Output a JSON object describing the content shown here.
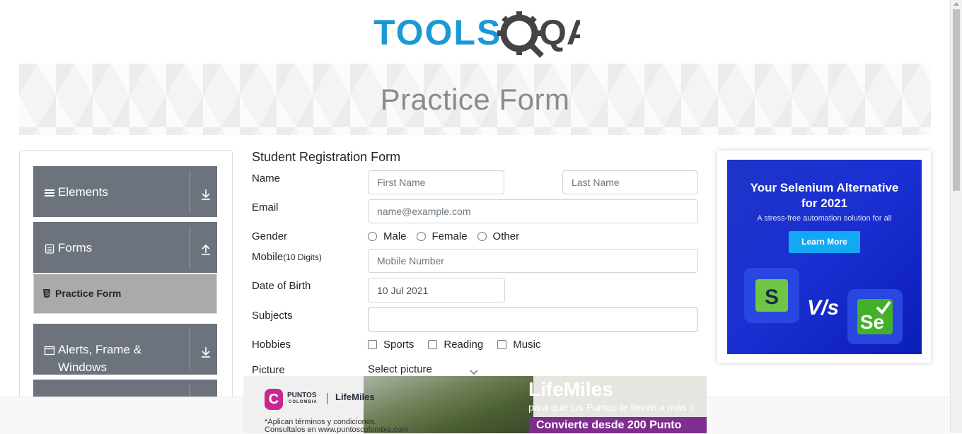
{
  "logo": {
    "text_part": "TOOLS",
    "text_part2": "QA"
  },
  "banner": {
    "title": "Practice Form"
  },
  "sidebar": {
    "groups": [
      {
        "label": "Elements",
        "icon": "hamburger-icon",
        "arrow": "download-arrow-icon"
      },
      {
        "label": "Forms",
        "icon": "document-icon",
        "arrow": "upload-arrow-icon"
      },
      {
        "label": "Alerts, Frame & Windows",
        "icon": "window-icon",
        "arrow": "download-arrow-icon"
      }
    ],
    "active_item": {
      "label": "Practice Form",
      "icon": "html5-icon"
    }
  },
  "form": {
    "title": "Student Registration Form",
    "name_label": "Name",
    "first_name_placeholder": "First Name",
    "last_name_placeholder": "Last Name",
    "email_label": "Email",
    "email_placeholder": "name@example.com",
    "gender_label": "Gender",
    "gender_options": [
      "Male",
      "Female",
      "Other"
    ],
    "mobile_label": "Mobile",
    "mobile_hint": "(10 Digits)",
    "mobile_placeholder": "Mobile Number",
    "dob_label": "Date of Birth",
    "dob_value": "10 Jul 2021",
    "subjects_label": "Subjects",
    "subjects_value": "",
    "hobbies_label": "Hobbies",
    "hobbies_options": [
      "Sports",
      "Reading",
      "Music"
    ],
    "picture_label": "Picture",
    "picture_select": "Select picture"
  },
  "side_ad": {
    "title_line1": "Your Selenium Alternative",
    "title_line2": "for 2021",
    "subtitle": "A stress-free automation solution for all",
    "button": "Learn More",
    "vs": "V/s",
    "tile_left": "S",
    "tile_right": "Se"
  },
  "bottom_ad": {
    "brand": "PUNTOS",
    "brand_sub": "COLOMBIA",
    "partner": "LifeMiles",
    "headline": "LifeMiles",
    "subline": "para que tus Puntos te lleven a más c",
    "cta": "Convierte desde 200 Punto",
    "legal_line1": "*Aplican términos y condiciones.",
    "legal_line2": "Consultalos en www.puntoscolombia.com"
  },
  "colors": {
    "accent": "#1b99d6",
    "sidebar": "#6c737d",
    "active": "#aaaaaa",
    "ad_blue": "#1a2fd2"
  }
}
